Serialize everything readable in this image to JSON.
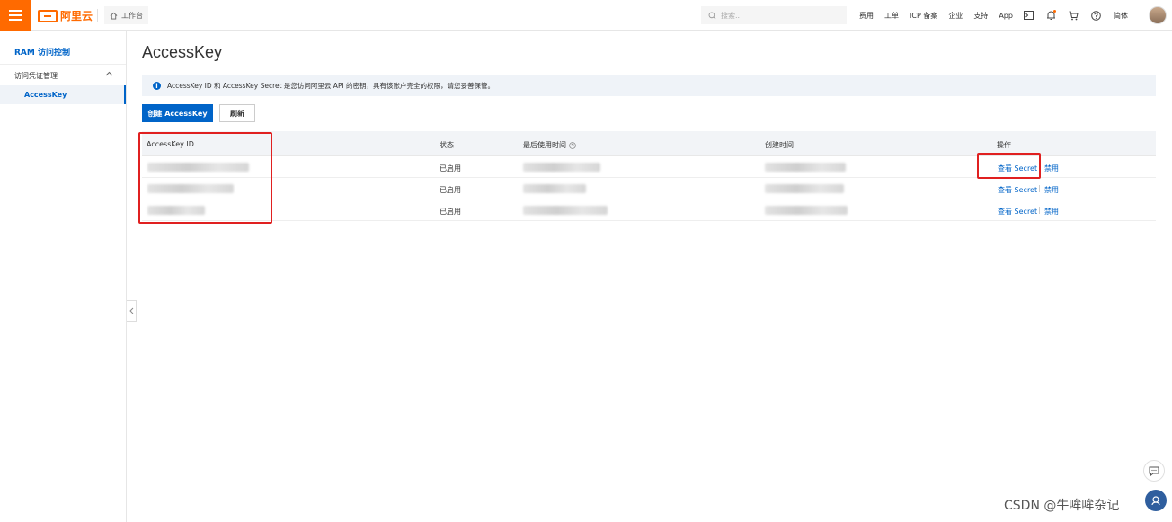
{
  "topbar": {
    "logo_text": "阿里云",
    "workbench_label": "工作台",
    "search_placeholder": "搜索...",
    "nav_items": [
      "费用",
      "工单",
      "ICP 备案",
      "企业",
      "支持",
      "App"
    ],
    "lang_label": "简体"
  },
  "sidebar": {
    "title": "RAM 访问控制",
    "group_label": "访问凭证管理",
    "active_item": "AccessKey"
  },
  "main": {
    "page_title": "AccessKey",
    "notice_text": "AccessKey ID 和 AccessKey Secret 是您访问阿里云 API 的密钥，具有该账户完全的权限，请您妥善保管。",
    "create_button": "创建 AccessKey",
    "refresh_button": "刷新",
    "table": {
      "headers": {
        "id": "AccessKey ID",
        "status": "状态",
        "last_used": "最后使用时间",
        "created": "创建时间",
        "actions": "操作"
      },
      "rows": [
        {
          "status": "已启用",
          "view_secret": "查看 Secret",
          "disable": "禁用"
        },
        {
          "status": "已启用",
          "view_secret": "查看 Secret",
          "disable": "禁用"
        },
        {
          "status": "已启用",
          "view_secret": "查看 Secret",
          "disable": "禁用"
        }
      ]
    }
  },
  "watermark": "CSDN @牛哞哞杂记",
  "colors": {
    "brand": "#ff6a00",
    "primary": "#0064c8",
    "highlight": "#e02020"
  }
}
